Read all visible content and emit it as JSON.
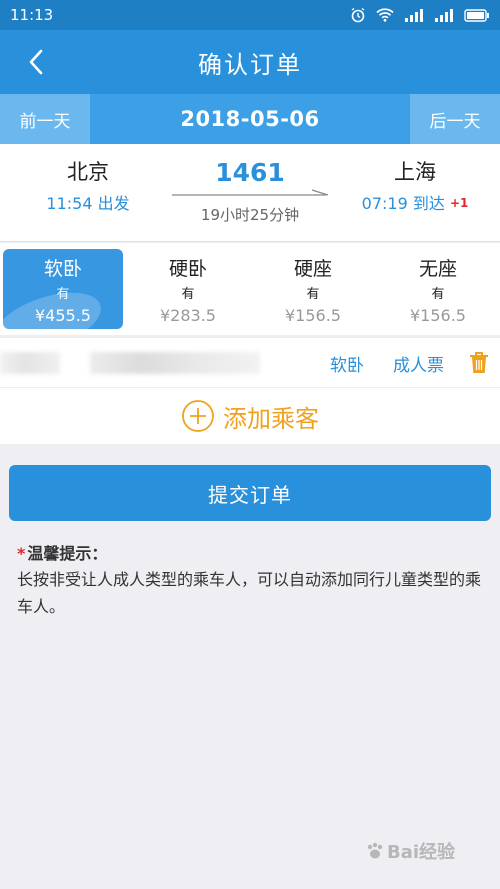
{
  "status_bar": {
    "time": "11:13"
  },
  "header": {
    "title": "确认订单"
  },
  "date_bar": {
    "prev": "前一天",
    "date": "2018-05-06",
    "next": "后一天"
  },
  "train": {
    "from": "北京",
    "depart_time": "11:54 出发",
    "number": "1461",
    "duration": "19小时25分钟",
    "to": "上海",
    "arrive_time": "07:19 到达",
    "day_offset": "+1"
  },
  "seats": [
    {
      "name": "软卧",
      "availability": "有",
      "price": "¥455.5",
      "selected": true
    },
    {
      "name": "硬卧",
      "availability": "有",
      "price": "¥283.5",
      "selected": false
    },
    {
      "name": "硬座",
      "availability": "有",
      "price": "¥156.5",
      "selected": false
    },
    {
      "name": "无座",
      "availability": "有",
      "price": "¥156.5",
      "selected": false
    }
  ],
  "passenger": {
    "seat_type": "软卧",
    "ticket_type": "成人票"
  },
  "add_passenger": {
    "label": "添加乘客"
  },
  "submit": {
    "label": "提交订单"
  },
  "tips": {
    "star": "*",
    "title": "温馨提示：",
    "text": "长按非受让人成人类型的乘车人，可以自动添加同行儿童类型的乘车人。"
  },
  "watermark": {
    "text": "Bai经验"
  },
  "colors": {
    "primary": "#2990dc",
    "accent": "#f0a11e",
    "alert": "#e0262e"
  }
}
